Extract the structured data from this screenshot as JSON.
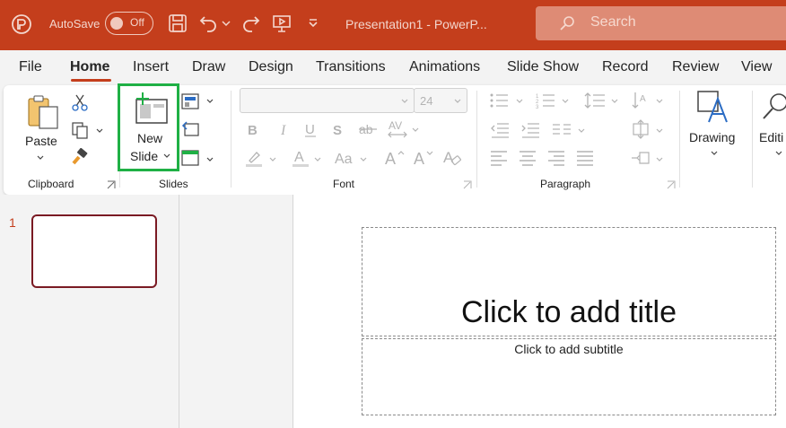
{
  "titlebar": {
    "autosave_label": "AutoSave",
    "autosave_state": "Off",
    "document_title": "Presentation1  -  PowerP...",
    "search_placeholder": "Search",
    "colors": {
      "background": "#c43e1c",
      "search_bg": "#de8b75"
    }
  },
  "tabs": [
    "File",
    "Home",
    "Insert",
    "Draw",
    "Design",
    "Transitions",
    "Animations",
    "Slide Show",
    "Record",
    "Review",
    "View"
  ],
  "active_tab": "Home",
  "ribbon": {
    "clipboard": {
      "paste_label": "Paste",
      "group_label": "Clipboard"
    },
    "slides": {
      "new_slide_label_1": "New",
      "new_slide_label_2": "Slide",
      "group_label": "Slides"
    },
    "font": {
      "font_name": "",
      "font_size": "24",
      "group_label": "Font"
    },
    "paragraph": {
      "group_label": "Paragraph"
    },
    "drawing": {
      "label": "Drawing"
    },
    "editing": {
      "label": "Editi"
    }
  },
  "slides_pane": {
    "slide_number": "1"
  },
  "slide": {
    "title_placeholder": "Click to add title",
    "subtitle_placeholder": "Click to add subtitle"
  },
  "icons": [
    "powerpoint-logo-icon",
    "save-icon",
    "undo-icon",
    "redo-icon",
    "present-icon",
    "customize-icon",
    "search-icon",
    "paste-icon",
    "cut-icon",
    "copy-icon",
    "format-painter-icon",
    "new-slide-icon",
    "layout-icon",
    "reset-icon",
    "section-icon",
    "bold-icon",
    "italic-icon",
    "underline-icon",
    "shadow-icon",
    "strikethrough-icon",
    "character-spacing-icon",
    "highlight-icon",
    "font-color-icon",
    "change-case-icon",
    "increase-font-icon",
    "decrease-font-icon",
    "clear-formatting-icon",
    "bullets-icon",
    "numbering-icon",
    "line-spacing-icon",
    "text-direction-icon",
    "decrease-indent-icon",
    "increase-indent-icon",
    "columns-icon",
    "align-text-icon",
    "align-left-icon",
    "center-icon",
    "align-right-icon",
    "justify-icon",
    "smartart-icon",
    "drawing-icon",
    "editing-icon"
  ]
}
